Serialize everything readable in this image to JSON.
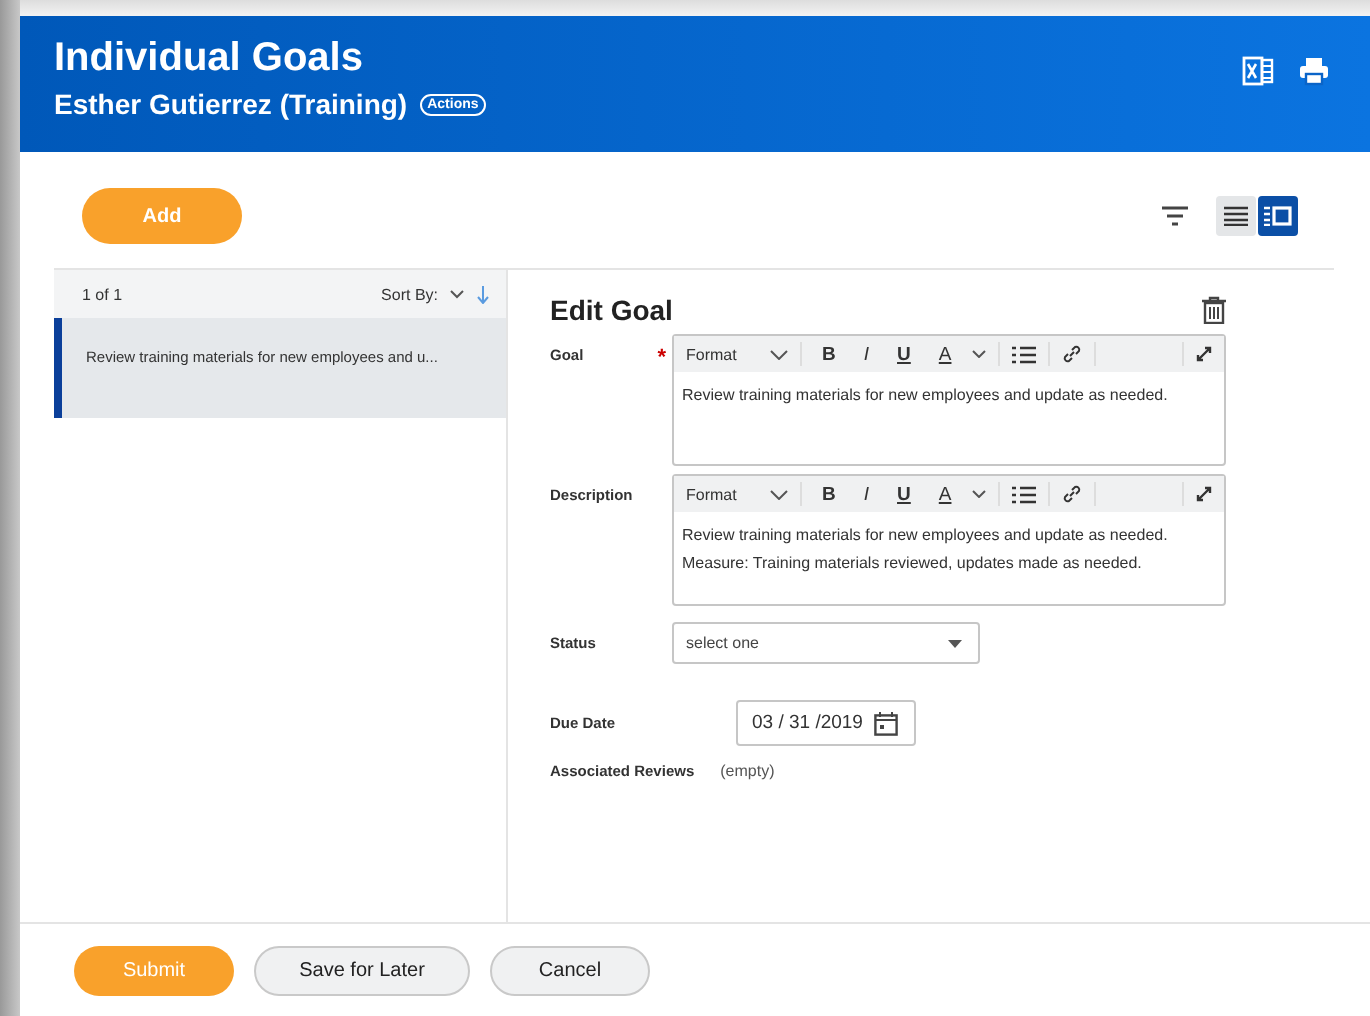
{
  "header": {
    "title": "Individual Goals",
    "subtitle": "Esther Gutierrez (Training)",
    "actions_label": "Actions"
  },
  "toolbar": {
    "add_label": "Add",
    "views": [
      {
        "kind": "list",
        "selected": false
      },
      {
        "kind": "detail",
        "selected": true
      }
    ]
  },
  "list": {
    "count": "1 of 1",
    "sort_label": "Sort By:",
    "items": [
      {
        "text": "Review training materials for new employees and u...",
        "selected": true
      }
    ]
  },
  "form": {
    "heading": "Edit Goal",
    "editors": [
      {
        "label": "Goal",
        "required_mark": "*",
        "format": "Format",
        "buttons": [
          "B",
          "I",
          "U",
          "A"
        ],
        "lines": [
          "Review training materials for new employees and update as needed."
        ]
      },
      {
        "label": "Description",
        "format": "Format",
        "buttons": [
          "B",
          "I",
          "U",
          "A"
        ],
        "lines": [
          "Review training materials for new employees and update as needed.",
          "Measure: Training materials reviewed, updates made as needed."
        ]
      }
    ],
    "status": {
      "label": "Status",
      "placeholder": "select one"
    },
    "due_date": {
      "label": "Due Date",
      "value": "03 / 31 /2019"
    },
    "reviews": {
      "label": "Associated Reviews",
      "value": "(empty)"
    }
  },
  "footer": {
    "buttons": [
      {
        "label": "Submit",
        "kind": "primary"
      },
      {
        "label": "Save for Later",
        "kind": "secondary"
      },
      {
        "label": "Cancel",
        "kind": "secondary"
      }
    ]
  }
}
